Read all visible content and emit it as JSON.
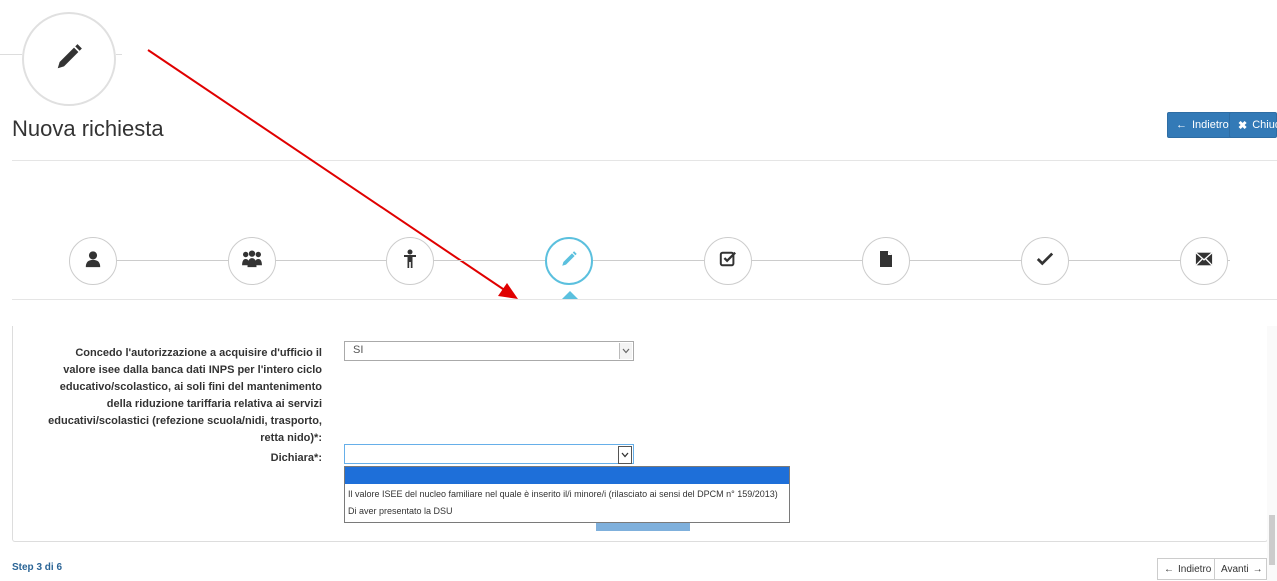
{
  "header": {
    "title": "Nuova richiesta",
    "icon": "pencil-icon",
    "buttons": {
      "back": "Indietro",
      "close": "Chiudi"
    }
  },
  "stepper": {
    "steps": [
      {
        "icon": "user-icon",
        "active": false
      },
      {
        "icon": "users-icon",
        "active": false
      },
      {
        "icon": "child-icon",
        "active": false
      },
      {
        "icon": "pencil-icon",
        "active": true
      },
      {
        "icon": "checkbox-icon",
        "active": false
      },
      {
        "icon": "file-icon",
        "active": false
      },
      {
        "icon": "checkmark-icon",
        "active": false
      },
      {
        "icon": "envelope-icon",
        "active": false
      }
    ]
  },
  "form": {
    "authorization": {
      "label": "Concedo l'autorizzazione a acquisire d'ufficio il valore isee dalla banca dati INPS per l'intero ciclo educativo/scolastico, ai soli fini del mantenimento della riduzione tariffaria relativa ai servizi educativi/scolastici (refezione scuola/nidi, trasporto, retta nido)*:",
      "value": "SI"
    },
    "dichiara": {
      "label": "Dichiara*:",
      "value": "",
      "options": [
        "",
        "Il valore ISEE del nucleo familiare nel quale è inserito il/i minore/i (rilasciato ai sensi del DPCM n° 159/2013)",
        "Di aver presentato la DSU"
      ]
    }
  },
  "footer": {
    "step_label": "Step 3 di 6",
    "back": "Indietro",
    "next": "Avanti"
  },
  "colors": {
    "primary": "#337ab7",
    "accent": "#5bc0de",
    "selection": "#1e6fd9",
    "annotation_arrow": "#e00000"
  }
}
